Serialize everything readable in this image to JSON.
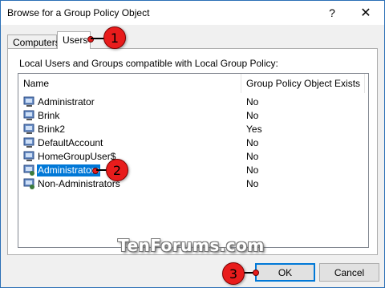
{
  "window": {
    "title": "Browse for a Group Policy Object",
    "help_glyph": "?",
    "close_glyph": "✕"
  },
  "tabs": [
    {
      "label": "Computers",
      "selected": false
    },
    {
      "label": "Users",
      "selected": true
    }
  ],
  "panel": {
    "description": "Local Users and Groups compatible with Local Group Policy:"
  },
  "list": {
    "columns": [
      "Name",
      "Group Policy Object Exists"
    ],
    "rows": [
      {
        "name": "Administrator",
        "exists": "No",
        "icon": "user-icon"
      },
      {
        "name": "Brink",
        "exists": "No",
        "icon": "user-icon"
      },
      {
        "name": "Brink2",
        "exists": "Yes",
        "icon": "user-icon"
      },
      {
        "name": "DefaultAccount",
        "exists": "No",
        "icon": "user-icon"
      },
      {
        "name": "HomeGroupUser$",
        "exists": "No",
        "icon": "user-icon"
      },
      {
        "name": "Administrators",
        "exists": "No",
        "icon": "group-icon",
        "selected": true
      },
      {
        "name": "Non-Administrators",
        "exists": "No",
        "icon": "group-icon"
      }
    ]
  },
  "buttons": {
    "ok": "OK",
    "cancel": "Cancel"
  },
  "watermark": "TenForums.com",
  "callouts": [
    "1",
    "2",
    "3"
  ],
  "colors": {
    "selection": "#0078d7",
    "callout": "#e81c1c",
    "window_border": "#2b6fb6"
  }
}
